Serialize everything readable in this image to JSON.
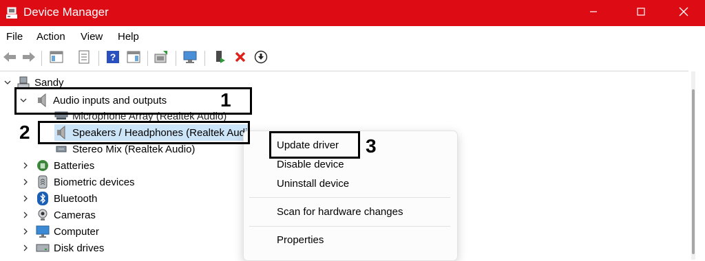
{
  "window": {
    "title": "Device Manager",
    "controls": {
      "minimize": "minimize-icon",
      "maximize": "maximize-icon",
      "close": "close-icon"
    },
    "accent": "#dd0b14"
  },
  "menu": {
    "items": [
      "File",
      "Action",
      "View",
      "Help"
    ]
  },
  "toolbar": {
    "buttons": [
      "back-icon",
      "forward-icon",
      "show-hide-console-tree-icon",
      "properties-icon",
      "help-icon",
      "action-pane-icon",
      "update-driver-icon",
      "scan-hardware-icon",
      "enable-device-icon",
      "uninstall-icon",
      "download-icon"
    ]
  },
  "tree": {
    "root": "Sandy",
    "audio": {
      "label": "Audio inputs and outputs",
      "children": [
        "Microphone Array (Realtek Audio)",
        "Speakers / Headphones (Realtek Audi",
        "Stereo Mix (Realtek Audio)"
      ]
    },
    "categories": [
      "Batteries",
      "Biometric devices",
      "Bluetooth",
      "Cameras",
      "Computer",
      "Disk drives"
    ]
  },
  "context_menu": {
    "items": [
      "Update driver",
      "Disable device",
      "Uninstall device",
      "Scan for hardware changes",
      "Properties"
    ]
  },
  "annotations": {
    "labels": [
      "1",
      "2",
      "3"
    ]
  }
}
